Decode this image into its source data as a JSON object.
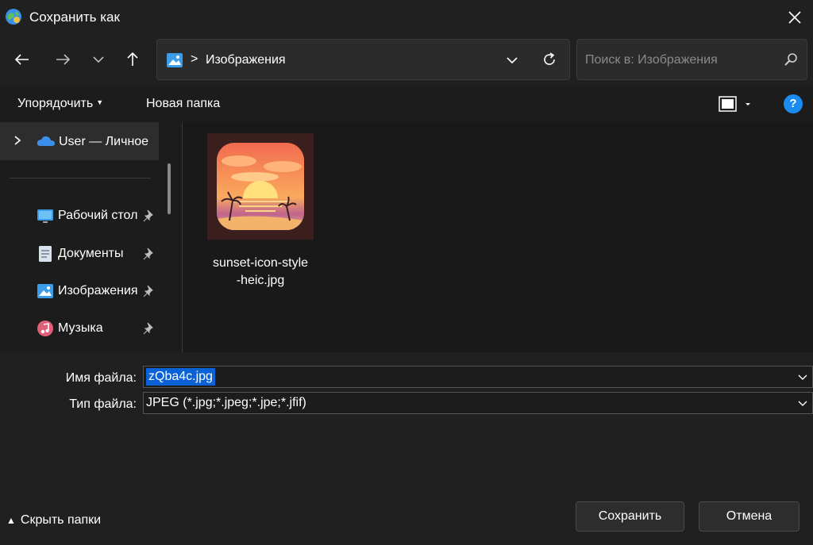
{
  "window": {
    "title": "Сохранить как"
  },
  "address": {
    "separator": ">",
    "path": "Изображения"
  },
  "search": {
    "placeholder": "Поиск в: Изображения"
  },
  "toolbar": {
    "organize": "Упорядочить",
    "new_folder": "Новая папка",
    "help": "?"
  },
  "sidebar": {
    "top": {
      "label": "User — Личное"
    },
    "items": [
      {
        "label": "Рабочий стол",
        "icon": "desktop-icon",
        "pinned": true
      },
      {
        "label": "Документы",
        "icon": "documents-icon",
        "pinned": true
      },
      {
        "label": "Изображения",
        "icon": "pictures-icon",
        "pinned": true
      },
      {
        "label": "Музыка",
        "icon": "music-icon",
        "pinned": true
      }
    ]
  },
  "files": [
    {
      "name": "sunset-icon-style-heic.jpg",
      "name_line1": "sunset-icon-style",
      "name_line2": "-heic.jpg",
      "type": "image"
    }
  ],
  "form": {
    "filename_label": "Имя файла:",
    "filename_value": "zQba4c.jpg",
    "filetype_label": "Тип файла:",
    "filetype_value": "JPEG (*.jpg;*.jpeg;*.jpe;*.jfif)"
  },
  "footer": {
    "hide_folders": "Скрыть папки",
    "save": "Сохранить",
    "cancel": "Отмена"
  },
  "colors": {
    "accent": "#1a8cf0",
    "selection": "#0a62d6",
    "background": "#202020"
  }
}
